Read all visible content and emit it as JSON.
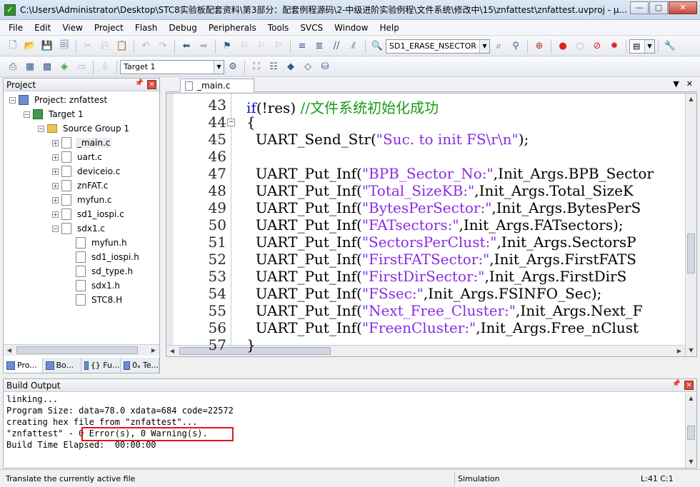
{
  "window": {
    "title": "C:\\Users\\Administrator\\Desktop\\STC8实验板配套资料\\第3部分：配套例程源码\\2-中级进阶实验例程\\文件系统\\修改中\\15\\znfattest\\znfattest.uvproj - µ...",
    "min": "—",
    "max": "□",
    "close": "✕"
  },
  "menu": [
    "File",
    "Edit",
    "View",
    "Project",
    "Flash",
    "Debug",
    "Peripherals",
    "Tools",
    "SVCS",
    "Window",
    "Help"
  ],
  "toolbar": {
    "find_value": "SD1_ERASE_NSECTOR",
    "target_value": "Target 1"
  },
  "project_panel": {
    "title": "Project",
    "tree": [
      {
        "label": "Project: znfattest",
        "indent": 0,
        "exp": "−",
        "icon": "proj"
      },
      {
        "label": "Target 1",
        "indent": 1,
        "exp": "−",
        "icon": "target"
      },
      {
        "label": "Source Group 1",
        "indent": 2,
        "exp": "−",
        "icon": "folder"
      },
      {
        "label": "_main.c",
        "indent": 3,
        "exp": "+",
        "icon": "file"
      },
      {
        "label": "uart.c",
        "indent": 3,
        "exp": "+",
        "icon": "file"
      },
      {
        "label": "deviceio.c",
        "indent": 3,
        "exp": "+",
        "icon": "file"
      },
      {
        "label": "znFAT.c",
        "indent": 3,
        "exp": "+",
        "icon": "file"
      },
      {
        "label": "myfun.c",
        "indent": 3,
        "exp": "+",
        "icon": "file"
      },
      {
        "label": "sd1_iospi.c",
        "indent": 3,
        "exp": "+",
        "icon": "file"
      },
      {
        "label": "sdx1.c",
        "indent": 3,
        "exp": "−",
        "icon": "file"
      },
      {
        "label": "myfun.h",
        "indent": 4,
        "exp": "",
        "icon": "file"
      },
      {
        "label": "sd1_iospi.h",
        "indent": 4,
        "exp": "",
        "icon": "file"
      },
      {
        "label": "sd_type.h",
        "indent": 4,
        "exp": "",
        "icon": "file"
      },
      {
        "label": "sdx1.h",
        "indent": 4,
        "exp": "",
        "icon": "file"
      },
      {
        "label": "STC8.H",
        "indent": 4,
        "exp": "",
        "icon": "file"
      }
    ],
    "tabs": [
      "Pro...",
      "Bo...",
      "{} Fu...",
      "0ₐ Te..."
    ]
  },
  "editor": {
    "tab_label": "_main.c",
    "lines": [
      {
        "no": "43",
        "fold": "",
        "segs": [
          [
            "kw",
            "if"
          ],
          [
            "",
            "(!res) "
          ],
          [
            "cm",
            "//文件系统初始化成功"
          ]
        ]
      },
      {
        "no": "44",
        "fold": "−",
        "segs": [
          [
            "",
            "{"
          ]
        ]
      },
      {
        "no": "45",
        "fold": "",
        "segs": [
          [
            "",
            "  UART_Send_Str("
          ],
          [
            "st",
            "\"Suc. to init FS\\r\\n\""
          ],
          [
            "",
            ");"
          ]
        ]
      },
      {
        "no": "46",
        "fold": "",
        "segs": [
          [
            "",
            ""
          ]
        ]
      },
      {
        "no": "47",
        "fold": "",
        "segs": [
          [
            "",
            "  UART_Put_Inf("
          ],
          [
            "st",
            "\"BPB_Sector_No:\""
          ],
          [
            "",
            ",Init_Args.BPB_Sector"
          ]
        ]
      },
      {
        "no": "48",
        "fold": "",
        "segs": [
          [
            "",
            "  UART_Put_Inf("
          ],
          [
            "st",
            "\"Total_SizeKB:\""
          ],
          [
            "",
            ",Init_Args.Total_SizeK"
          ]
        ]
      },
      {
        "no": "49",
        "fold": "",
        "segs": [
          [
            "",
            "  UART_Put_Inf("
          ],
          [
            "st",
            "\"BytesPerSector:\""
          ],
          [
            "",
            ",Init_Args.BytesPerS"
          ]
        ]
      },
      {
        "no": "50",
        "fold": "",
        "segs": [
          [
            "",
            "  UART_Put_Inf("
          ],
          [
            "st",
            "\"FATsectors:\""
          ],
          [
            "",
            ",Init_Args.FATsectors);"
          ]
        ]
      },
      {
        "no": "51",
        "fold": "",
        "segs": [
          [
            "",
            "  UART_Put_Inf("
          ],
          [
            "st",
            "\"SectorsPerClust:\""
          ],
          [
            "",
            ",Init_Args.SectorsP"
          ]
        ]
      },
      {
        "no": "52",
        "fold": "",
        "segs": [
          [
            "",
            "  UART_Put_Inf("
          ],
          [
            "st",
            "\"FirstFATSector:\""
          ],
          [
            "",
            ",Init_Args.FirstFATS"
          ]
        ]
      },
      {
        "no": "53",
        "fold": "",
        "segs": [
          [
            "",
            "  UART_Put_Inf("
          ],
          [
            "st",
            "\"FirstDirSector:\""
          ],
          [
            "",
            ",Init_Args.FirstDirS"
          ]
        ]
      },
      {
        "no": "54",
        "fold": "",
        "segs": [
          [
            "",
            "  UART_Put_Inf("
          ],
          [
            "st",
            "\"FSsec:\""
          ],
          [
            "",
            ",Init_Args.FSINFO_Sec);"
          ]
        ]
      },
      {
        "no": "55",
        "fold": "",
        "segs": [
          [
            "",
            "  UART_Put_Inf("
          ],
          [
            "st",
            "\"Next_Free_Cluster:\""
          ],
          [
            "",
            ",Init_Args.Next_F"
          ]
        ]
      },
      {
        "no": "56",
        "fold": "",
        "segs": [
          [
            "",
            "  UART_Put_Inf("
          ],
          [
            "st",
            "\"FreenCluster:\""
          ],
          [
            "",
            ",Init_Args.Free_nClust"
          ]
        ]
      },
      {
        "no": "57",
        "fold": "",
        "segs": [
          [
            "",
            "}"
          ]
        ]
      }
    ]
  },
  "build_output": {
    "title": "Build Output",
    "lines": [
      "linking...",
      "Program Size: data=78.0 xdata=684 code=22572",
      "creating hex file from \"znfattest\"...",
      "\"znfattest\" - 0 Error(s), 0 Warning(s).",
      "Build Time Elapsed:  00:00:00"
    ]
  },
  "status": {
    "hint": "Translate the currently active file",
    "mode": "Simulation",
    "position": "L:41 C:1"
  },
  "colors": {
    "keyword": "#1010c8",
    "comment": "#1a9a1a",
    "string": "#8a2be2",
    "highlight_box": "#e0161a"
  }
}
